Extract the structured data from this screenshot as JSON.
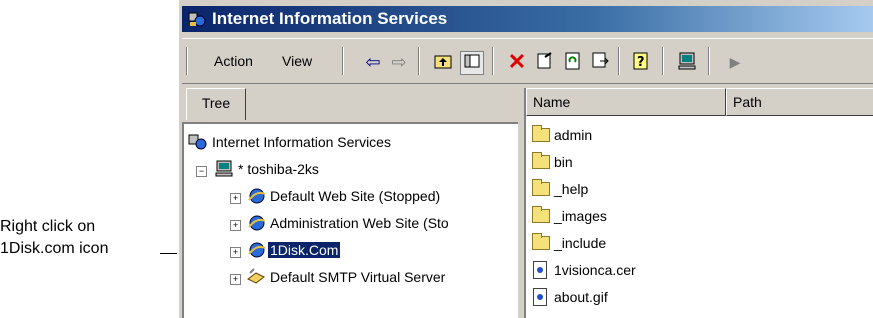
{
  "callout": {
    "line1": "Right click on",
    "line2": "1Disk.com icon"
  },
  "window": {
    "title": "Internet Information Services"
  },
  "toolbar": {
    "action_label": "Action",
    "view_label": "View",
    "icons": [
      "back-icon",
      "forward-icon",
      "up-folder-icon",
      "show-tree-icon",
      "delete-icon",
      "properties-icon",
      "refresh-icon",
      "export-icon",
      "help-icon",
      "computer-icon",
      "play-icon"
    ]
  },
  "tree": {
    "tab_label": "Tree",
    "root_label": "Internet Information Services",
    "server_label": "* toshiba-2ks",
    "items": [
      {
        "label": "Default Web Site (Stopped)"
      },
      {
        "label": "Administration Web Site (Sto"
      },
      {
        "label": "1Disk.Com"
      },
      {
        "label": "Default SMTP Virtual Server"
      }
    ]
  },
  "list": {
    "columns": [
      "Name",
      "Path"
    ],
    "rows": [
      {
        "name": "admin",
        "type": "folder"
      },
      {
        "name": "bin",
        "type": "folder"
      },
      {
        "name": "_help",
        "type": "folder"
      },
      {
        "name": "_images",
        "type": "folder"
      },
      {
        "name": "_include",
        "type": "folder"
      },
      {
        "name": "1visionca.cer",
        "type": "file"
      },
      {
        "name": "about.gif",
        "type": "file"
      }
    ]
  },
  "colors": {
    "titlebar_start": "#0a246a",
    "titlebar_end": "#a6caf0",
    "selection": "#0a246a",
    "face": "#d4d0c8"
  }
}
